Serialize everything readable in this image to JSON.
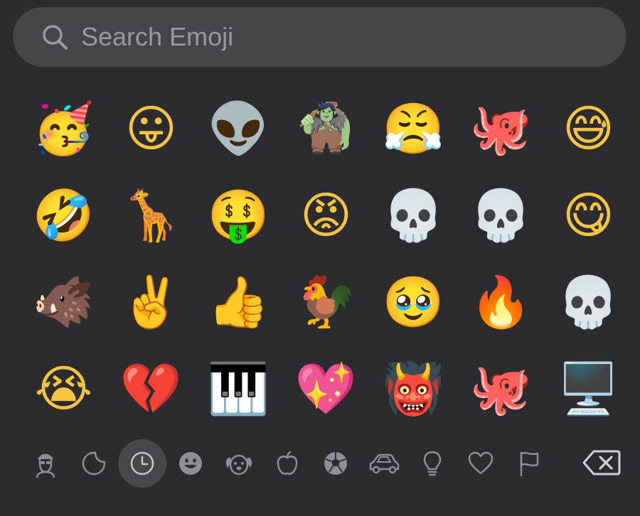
{
  "search": {
    "placeholder": "Search Emoji",
    "value": ""
  },
  "emojis": [
    {
      "name": "partying-face",
      "char": "🥳"
    },
    {
      "name": "face-with-tongue",
      "char": "😛"
    },
    {
      "name": "alien-mind-blown-memoji",
      "char": "👽"
    },
    {
      "name": "troll-memoji",
      "char": "🧌"
    },
    {
      "name": "face-with-steam",
      "char": "😤"
    },
    {
      "name": "octopus-memoji",
      "char": "🐙"
    },
    {
      "name": "grinning-sweat",
      "char": "😅"
    },
    {
      "name": "rolling-on-floor-laughing",
      "char": "🤣"
    },
    {
      "name": "giraffe-memoji",
      "char": "🦒"
    },
    {
      "name": "money-mouth-face",
      "char": "🤑"
    },
    {
      "name": "pouting-face",
      "char": "😡"
    },
    {
      "name": "skull-star-struck-memoji",
      "char": "💀"
    },
    {
      "name": "skull-memoji",
      "char": "💀"
    },
    {
      "name": "face-savoring-food",
      "char": "😋"
    },
    {
      "name": "boar-mind-blown-memoji",
      "char": "🐗"
    },
    {
      "name": "victory-hand",
      "char": "✌️"
    },
    {
      "name": "thumbs-up",
      "char": "👍"
    },
    {
      "name": "rooster",
      "char": "🐓"
    },
    {
      "name": "face-holding-back-tears",
      "char": "🥹"
    },
    {
      "name": "fire",
      "char": "🔥"
    },
    {
      "name": "skull-sleeping-memoji",
      "char": "💀"
    },
    {
      "name": "loudly-crying-face",
      "char": "😭"
    },
    {
      "name": "broken-heart",
      "char": "💔"
    },
    {
      "name": "grand-piano",
      "char": "🎹"
    },
    {
      "name": "sparkling-heart",
      "char": "💖"
    },
    {
      "name": "ogre",
      "char": "👹"
    },
    {
      "name": "octopus-kiss-memoji",
      "char": "🐙"
    },
    {
      "name": "desktop-computer",
      "char": "🖥️"
    }
  ],
  "categories": [
    {
      "name": "memoji",
      "active": false
    },
    {
      "name": "stickers",
      "active": false
    },
    {
      "name": "frequently-used",
      "active": true
    },
    {
      "name": "smileys",
      "active": false
    },
    {
      "name": "animals",
      "active": false
    },
    {
      "name": "food",
      "active": false
    },
    {
      "name": "activity",
      "active": false
    },
    {
      "name": "travel",
      "active": false
    },
    {
      "name": "objects",
      "active": false
    },
    {
      "name": "symbols",
      "active": false
    },
    {
      "name": "flags",
      "active": false
    }
  ],
  "colors": {
    "background": "#2c2c2e",
    "search_bg": "#464648",
    "placeholder": "#9a9aa0",
    "icon_gray": "#8e8e93",
    "active_bg": "#48484a"
  }
}
